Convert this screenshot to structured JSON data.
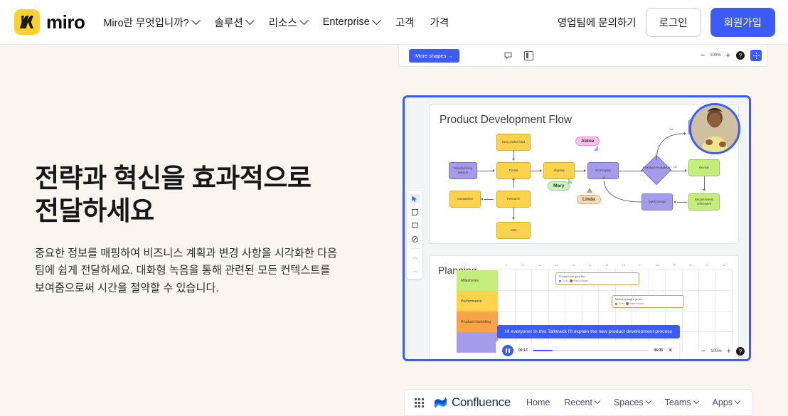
{
  "header": {
    "logo_text": "miro",
    "logo_icon": "miro-logo-icon",
    "nav": [
      {
        "label": "Miro란 무엇입니까?",
        "has_caret": true
      },
      {
        "label": "솔루션",
        "has_caret": true
      },
      {
        "label": "리소스",
        "has_caret": true
      },
      {
        "label": "Enterprise",
        "has_caret": true
      },
      {
        "label": "고객",
        "has_caret": false
      },
      {
        "label": "가격",
        "has_caret": false
      }
    ],
    "contact_sales": "영업팀에 문의하기",
    "login": "로그인",
    "signup": "회원가입",
    "accent_color": "#3b5bfd",
    "logo_bg": "#ffd02f"
  },
  "hero": {
    "title": "전략과 혁신을 효과적으로 전달하세요",
    "body": "중요한 정보를 매핑하여 비즈니스 계획과 변경 사항을 시각화한 다음 팀에 쉽게 전달하세요. 대화형 녹음을 통해 관련된 모든 컨텍스트를 보여줌으로써 시간을 절약할 수 있습니다."
  },
  "toolbar": {
    "more_shapes": "More shapes →",
    "chat_icon": "chat-icon",
    "panel_icon": "panel-icon",
    "zoom_out": "−",
    "zoom_level": "100%",
    "zoom_in": "+",
    "help": "?",
    "grid_icon": "grid-icon"
  },
  "board": {
    "border_color": "#3b5bfd",
    "vtools": [
      {
        "name": "cursor-tool",
        "glyph": "➤",
        "active": true
      },
      {
        "name": "sticky-note-tool",
        "glyph": "▢",
        "active": false
      },
      {
        "name": "comment-tool",
        "glyph": "▣",
        "active": false
      },
      {
        "name": "pen-tool",
        "glyph": "◕",
        "active": false
      },
      {
        "name": "undo-tool",
        "glyph": "↶",
        "active": false
      },
      {
        "name": "redo-tool",
        "glyph": "↷",
        "active": false
      }
    ],
    "flow": {
      "title": "Product Development Flow",
      "nodes": [
        {
          "id": "new-product-idea",
          "label": "New product idea",
          "color": "yellow"
        },
        {
          "id": "brainstorming-session",
          "label": "Brainstorming session",
          "color": "purple"
        },
        {
          "id": "trends",
          "label": "Trends",
          "color": "yellow"
        },
        {
          "id": "aligning",
          "label": "Aligning",
          "color": "yellow"
        },
        {
          "id": "prototyping",
          "label": "Prototyping",
          "color": "purple"
        },
        {
          "id": "prototype-evaluation",
          "label": "Prototype evaluation",
          "color": "purple"
        },
        {
          "id": "review",
          "label": "Review",
          "color": "green"
        },
        {
          "id": "requirements-refinement",
          "label": "Requirements refinement",
          "color": "green"
        },
        {
          "id": "quick-design",
          "label": "Quick Design",
          "color": "purple"
        },
        {
          "id": "competition",
          "label": "Competition",
          "color": "yellow"
        },
        {
          "id": "research",
          "label": "Research",
          "color": "yellow"
        },
        {
          "id": "user",
          "label": "User",
          "color": "yellow"
        }
      ],
      "edge_labels": {
        "yes": "Yes",
        "no": "No"
      },
      "cursors": [
        {
          "name": "Abbie",
          "color": "#f8c2ec"
        },
        {
          "name": "Mary",
          "color": "#c8f5c2"
        },
        {
          "name": "Linda",
          "color": "#fad9b8"
        }
      ],
      "video_bubble": "participant-video-bubble"
    },
    "planning": {
      "title": "Planning",
      "timeline": [
        "9",
        "10",
        "11",
        "12",
        "13",
        "14",
        "15",
        "16",
        "17",
        "18",
        "19",
        "20",
        "21",
        "22"
      ],
      "rows": [
        {
          "label": "Milestones",
          "color": "#c4ee7c"
        },
        {
          "label": "Performance",
          "color": "#fcd34b"
        },
        {
          "label": "Product marketing",
          "color": "#f7a34a"
        },
        {
          "label": "",
          "color": "#a69beb"
        }
      ],
      "tasks": [
        {
          "title": "Product Hunt goes live",
          "status": "To do",
          "assignee": "Rubin Kowacz"
        },
        {
          "title": "Marketing pages go live",
          "status": "To do",
          "assignee": "Rubin Kowacz"
        }
      ]
    },
    "talktrack": "Hi everyone! In this Talktrack I'll explain the new product development process",
    "player": {
      "current_time": "00:17",
      "total_time": "06:35",
      "progress_percent": 17,
      "play_state": "paused",
      "close_icon": "close-icon"
    },
    "bottom_zoom": {
      "out": "−",
      "level": "100%",
      "in": "+",
      "help": "?"
    }
  },
  "confluence": {
    "apps_icon": "apps-grid-icon",
    "logo_icon": "confluence-logo-icon",
    "name": "Confluence",
    "nav": [
      {
        "label": "Home",
        "has_caret": false
      },
      {
        "label": "Recent",
        "has_caret": true
      },
      {
        "label": "Spaces",
        "has_caret": true
      },
      {
        "label": "Teams",
        "has_caret": true
      },
      {
        "label": "Apps",
        "has_caret": true
      }
    ],
    "brand_color": "#0052cc"
  }
}
